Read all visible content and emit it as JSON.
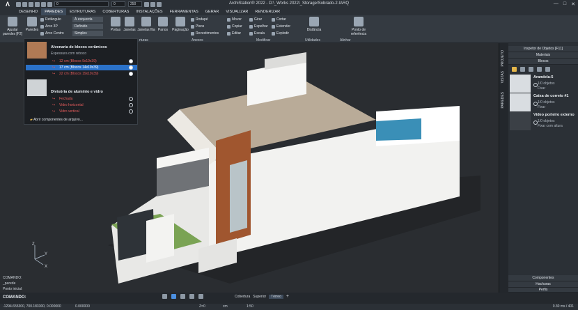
{
  "app": {
    "title": "ArchiStation® 2022 - D:\\_Works 2022\\_Storage\\Sobrado-2.IARQ",
    "layer_value": "0",
    "layer2_value": "0",
    "zoom_value": "250"
  },
  "menu": {
    "items": [
      "DESENHO",
      "PAREDES",
      "ESTRUTURAS",
      "COBERTURAS",
      "INSTALAÇÕES",
      "FERRAMENTAS",
      "GERAR",
      "VISUALIZAR",
      "RENDERIZAR"
    ],
    "active": "PAREDES"
  },
  "ribbon": {
    "ajustar": "Ajustar paredes [F2]",
    "retangulo": "Retângulo",
    "arco3p": "Arco 3P",
    "arco_centro": "Arco Centro",
    "a_esquerda": "À esquerda",
    "definido": "Definido",
    "simples": "Simples",
    "paredes": "Paredes",
    "portas": "Portas",
    "janelas": "Janelas",
    "janelas_fita": "Janelas fita",
    "panos": "Panos",
    "paginacao": "Paginação",
    "rodape": "Rodapé",
    "pisos": "Pisos",
    "revestimentos": "Revestimentos",
    "mover": "Mover",
    "copiar": "Copiar",
    "editar": "Editar",
    "girar": "Girar",
    "espelhar": "Espelhar",
    "escala": "Escala",
    "cortar": "Cortar",
    "estender": "Estender",
    "explodir": "Explodir",
    "distancia": "Distância",
    "ponto_ref": "Ponto de referência",
    "sec_aberturas": "rturas",
    "sec_anexos": "Anexos",
    "sec_modificar": "Modificar",
    "sec_utilidades": "Utilidades",
    "sec_alinhar": "Alinhar"
  },
  "popup": {
    "group1_title": "Alvenaria de blocos cerâmicos",
    "group1_sub": "Espessura com reboco",
    "rows1": [
      "12 cm (Blocos 9x19x39)",
      "17 cm (Blocos 14x19x39)",
      "22 cm (Blocos 19x19x39)"
    ],
    "group2_title": "Divisória de alumínio e vidro",
    "rows2": [
      "Fechada",
      "Vidro horizontal",
      "Vidro vertical"
    ],
    "open_components": "Abrir componentes de arquivo..."
  },
  "vtabs": [
    "PROJETO",
    "VISTAS",
    "PAREDES"
  ],
  "inspector": {
    "title": "Inspetor de Objetos [F11]",
    "tab_materiais": "Materiais",
    "tab_blocos": "Blocos",
    "objects": [
      {
        "name": "Arandela-5",
        "l1": "1/0 objetos",
        "l2": "Fixar"
      },
      {
        "name": "Caixa de correio #1",
        "l1": "1/0 objetos",
        "l2": "Fixar"
      },
      {
        "name": "Vídeo porteiro externo",
        "l1": "1/0 objetos",
        "l2": "Fixar com altura"
      }
    ],
    "bottom_tabs": [
      "Componentes",
      "Hachuras",
      "Perfis"
    ]
  },
  "command": {
    "history": [
      "COMANDO:",
      "_parede",
      "Ponto inicial:"
    ],
    "prompt": "COMANDO:"
  },
  "viewtabs": [
    "Cobertura",
    "Superior",
    "Térreo"
  ],
  "status": {
    "coords": "-1294.655300, 700.183300, 0.000000",
    "angle": "0.000000",
    "z": "Z=0",
    "unit": "cm",
    "scale": "1:50",
    "disk": "0.30 ms / 401"
  }
}
